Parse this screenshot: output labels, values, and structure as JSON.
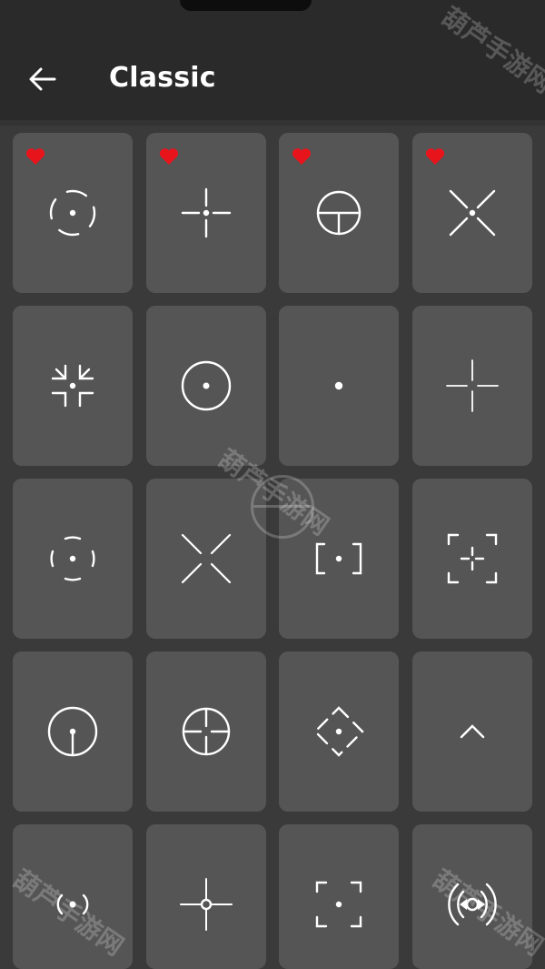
{
  "header": {
    "title": "Classic",
    "back_icon": "arrow-left-icon"
  },
  "colors": {
    "background": "#3a3a3a",
    "header": "#2a2a2a",
    "card": "#555555",
    "heart": "#e8141c",
    "crosshair": "#ffffff"
  },
  "watermark": {
    "text": "葫芦手游网"
  },
  "crosshairs": [
    {
      "icon": "crosshair-dashed-circle-icon",
      "favorite": true
    },
    {
      "icon": "crosshair-cross-dot-icon",
      "favorite": true
    },
    {
      "icon": "crosshair-scope-circle-icon",
      "favorite": true
    },
    {
      "icon": "crosshair-x-dot-icon",
      "favorite": true
    },
    {
      "icon": "crosshair-corner-brackets-icon",
      "favorite": false
    },
    {
      "icon": "crosshair-circle-dot-icon",
      "favorite": false
    },
    {
      "icon": "crosshair-dot-icon",
      "favorite": false
    },
    {
      "icon": "crosshair-thin-cross-icon",
      "favorite": false
    },
    {
      "icon": "crosshair-arc-circle-icon",
      "favorite": false
    },
    {
      "icon": "crosshair-x-gap-icon",
      "favorite": false
    },
    {
      "icon": "crosshair-square-bracket-dot-icon",
      "favorite": false
    },
    {
      "icon": "crosshair-frame-cross-icon",
      "favorite": false
    },
    {
      "icon": "crosshair-circle-post-icon",
      "favorite": false
    },
    {
      "icon": "crosshair-circle-cross-icon",
      "favorite": false
    },
    {
      "icon": "crosshair-diamond-dot-icon",
      "favorite": false
    },
    {
      "icon": "crosshair-chevron-icon",
      "favorite": false
    },
    {
      "icon": "crosshair-signal-dot-icon",
      "favorite": false
    },
    {
      "icon": "crosshair-cross-small-circle-icon",
      "favorite": false
    },
    {
      "icon": "crosshair-frame-dot-icon",
      "favorite": false
    },
    {
      "icon": "crosshair-ornate-icon",
      "favorite": false
    }
  ]
}
